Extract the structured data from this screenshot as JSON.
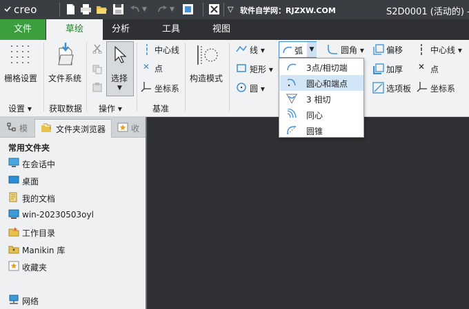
{
  "titlebar": {
    "logo": "creo",
    "site": "软件自学网：RJZXW.COM",
    "window_title": "S2D0001 (活动的) -"
  },
  "tabs": {
    "file": "文件",
    "sketch": "草绘",
    "analysis": "分析",
    "tools": "工具",
    "view": "视图"
  },
  "ribbon": {
    "grid_settings": "栅格设置",
    "file_system": "文件系统",
    "select": "选择",
    "centerline": "中心线",
    "point": "点",
    "coordsys": "坐标系",
    "construction_mode": "构造模式",
    "line": "线",
    "rectangle": "矩形",
    "circle": "圆",
    "arc": "弧",
    "fillet": "圆角",
    "offset": "偏移",
    "thicken": "加厚",
    "palette": "选项板",
    "centerline2": "中心线",
    "point2": "点",
    "coordsys2": "坐标系",
    "groups": {
      "settings": "设置",
      "get_data": "获取数据",
      "operations": "操作",
      "datum": "基准"
    }
  },
  "arc_menu": [
    "3点/相切端",
    "圆心和端点",
    "3 相切",
    "同心",
    "圆锥"
  ],
  "panel": {
    "tabs": [
      "模",
      "文件夹浏览器",
      "收"
    ],
    "section": "常用文件夹",
    "items": [
      "在会话中",
      "桌面",
      "我的文档",
      "win-20230503oyl",
      "工作目录",
      "Manikin 库",
      "收藏夹"
    ],
    "network": "网络"
  }
}
